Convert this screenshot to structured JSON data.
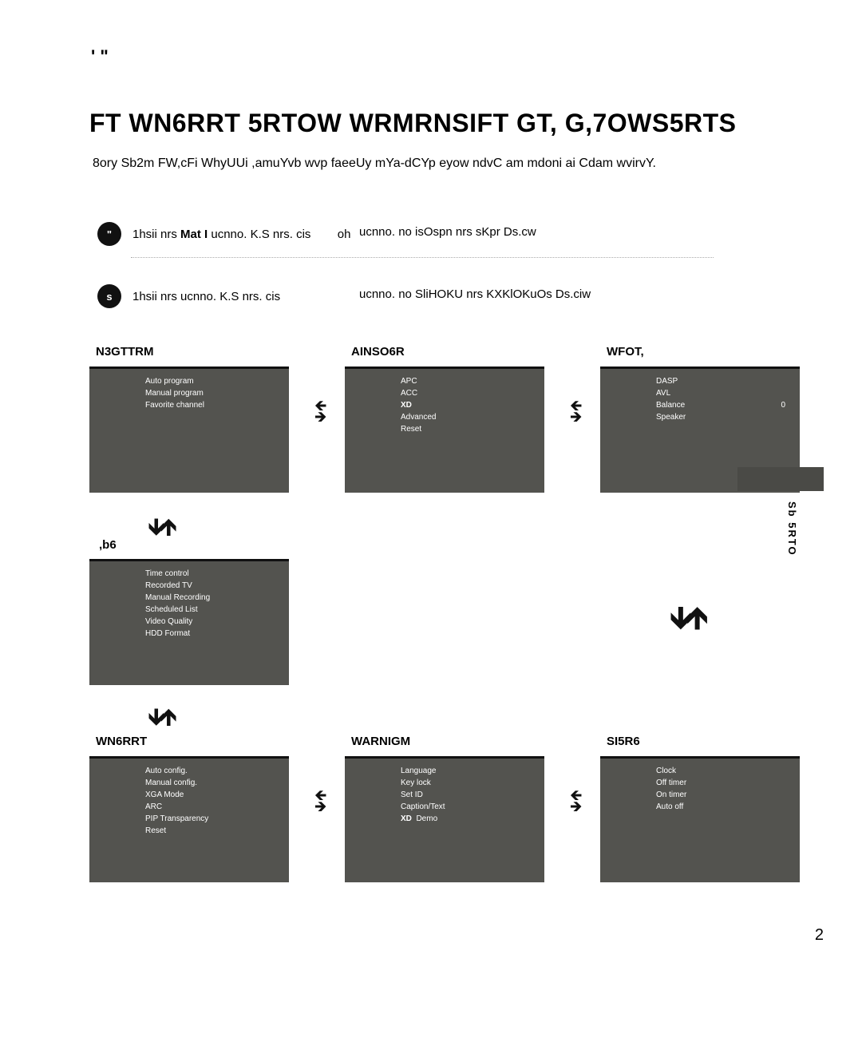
{
  "top_mark": "' \"",
  "title": "FT WN6RRT 5RTOW WRMRNSIFT GT, G,7OWS5RTS",
  "subtitle": "8ory Sb2m FW,cFi WhyUUi ,amuYvb wvp faeeUy mYa-dCYp eyow ndvC am mdoni ai Cdam wvirvY.",
  "step1": {
    "circle": "\"",
    "text_left_pre": "1hsii nrs ",
    "text_left_bold": "Mat I",
    "text_left_post": "  ucnno. K.S nrs. cis",
    "text_mid": "oh",
    "text_right": "ucnno. no isOspn nrs sKpr Ds.cw"
  },
  "step2": {
    "circle": "s",
    "text_left": "1hsii nrs    ucnno. K.S nrs. cis",
    "text_right": "ucnno. no SliHOKU nrs KXKlOKuOs Ds.ciw"
  },
  "cards_top": [
    {
      "label": "N3GTTRM",
      "items": [
        "Auto program",
        "Manual program",
        "Favorite channel"
      ]
    },
    {
      "label": "AINSO6R",
      "items": [
        "APC",
        "ACC",
        "XD",
        "Advanced",
        "Reset"
      ],
      "bold_index": 2
    },
    {
      "label": "WFOT,",
      "items": [
        {
          "l": "DASP",
          "v": ""
        },
        {
          "l": "AVL",
          "v": ""
        },
        {
          "l": "Balance",
          "v": "0"
        },
        {
          "l": "Speaker",
          "v": ""
        }
      ]
    }
  ],
  "pvr": {
    "label": ",b6",
    "items": [
      "Time control",
      "Recorded TV",
      "Manual Recording",
      "Scheduled List",
      "Video Quality",
      "HDD Format"
    ]
  },
  "cards_bottom": [
    {
      "label": "WN6RRT",
      "items": [
        "Auto config.",
        "Manual config.",
        "XGA Mode",
        "ARC",
        "PIP Transparency",
        "Reset"
      ]
    },
    {
      "label": "WARNIGM",
      "items": [
        "Language",
        "Key lock",
        "Set ID",
        "Caption/Text",
        "XD  Demo"
      ],
      "bold_prefix_index": 4
    },
    {
      "label": "SI5R6",
      "items": [
        "Clock",
        "Off timer",
        "On timer",
        "Auto off"
      ]
    }
  ],
  "side_text": "Sb 5RTO",
  "page": "2"
}
